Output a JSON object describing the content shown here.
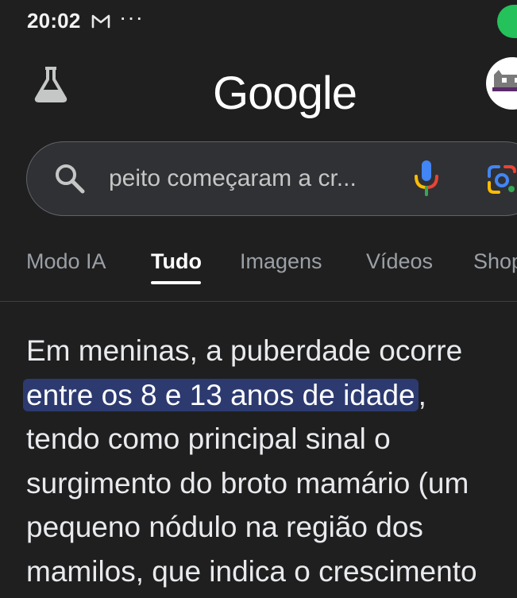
{
  "status_bar": {
    "time": "20:02",
    "overflow": "···",
    "mail_icon": "gmail-icon"
  },
  "header": {
    "logo": "Google",
    "labs_icon": "flask-icon",
    "avatar_icon": "avatar"
  },
  "search": {
    "query": "peito começaram a cr...",
    "mic_icon": "mic-icon",
    "lens_icon": "lens-icon"
  },
  "tabs": [
    {
      "label": "Modo IA",
      "active": false
    },
    {
      "label": "Tudo",
      "active": true
    },
    {
      "label": "Imagens",
      "active": false
    },
    {
      "label": "Vídeos",
      "active": false
    },
    {
      "label": "Shop",
      "active": false
    }
  ],
  "answer": {
    "line1": "Em meninas, a puberdade ocorre",
    "highlight": "entre os 8 e 13 anos de idade",
    "line2_tail": ",",
    "line3": "tendo como principal sinal o",
    "line4": "surgimento do broto mamário (um",
    "line5": "pequeno nódulo na região dos",
    "line6": "mamilos, que indica o crescimento"
  },
  "colors": {
    "background": "#1f1f1f",
    "highlight": "#2c3a70",
    "status_green": "#25c15a"
  }
}
